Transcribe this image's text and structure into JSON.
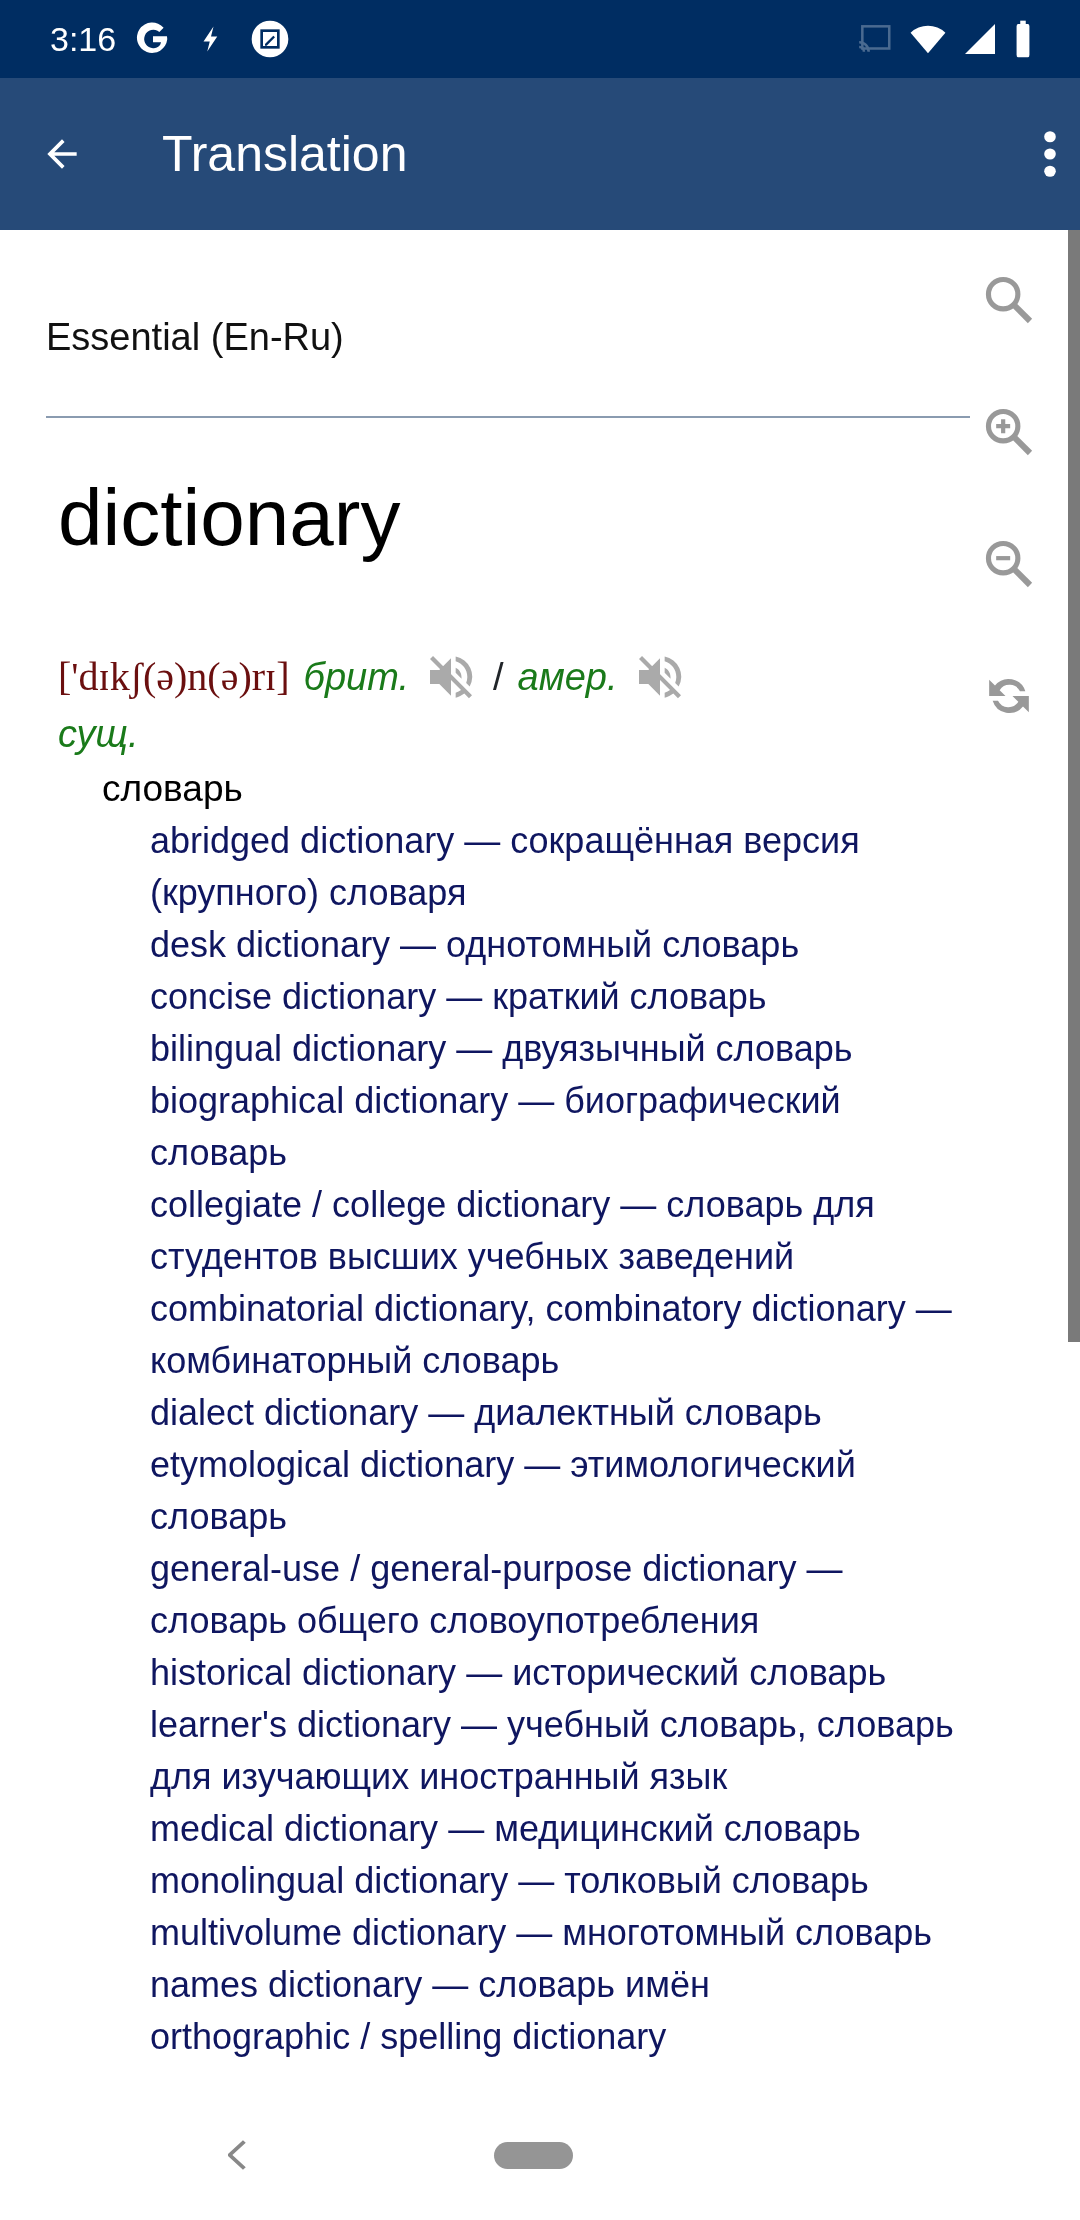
{
  "status_bar": {
    "time": "3:16"
  },
  "app_bar": {
    "title": "Translation"
  },
  "dictionary": {
    "name": "Essential (En-Ru)"
  },
  "entry": {
    "headword": "dictionary",
    "transcription": "['dɪkʃ(ə)n(ə)rɪ]",
    "variant_british": "брит.",
    "separator": "/",
    "variant_american": "амер.",
    "part_of_speech": "сущ.",
    "translation": "словарь",
    "examples": [
      "abridged dictionary — сокращённая версия (крупного) словаря",
      "desk dictionary — однотомный словарь",
      "concise dictionary — краткий словарь",
      "bilingual dictionary — двуязычный словарь",
      "biographical dictionary — биографический словарь",
      "collegiate / college dictionary — словарь для студентов высших учебных заведений",
      "combinatorial dictionary, combinatory dictionary — комбинаторный словарь",
      "dialect dictionary — диалектный словарь",
      "etymological dictionary — этимологический словарь",
      "general-use / general-purpose dictionary — словарь общего словоупотребления",
      "historical dictionary — исторический словарь",
      "learner's dictionary — учебный словарь, словарь для изучающих иностранный язык",
      "medical dictionary — медицинский словарь",
      "monolingual dictionary — толковый словарь",
      "multivolume dictionary — многотомный словарь",
      "names dictionary — словарь имён",
      "orthographic / spelling dictionary"
    ]
  }
}
